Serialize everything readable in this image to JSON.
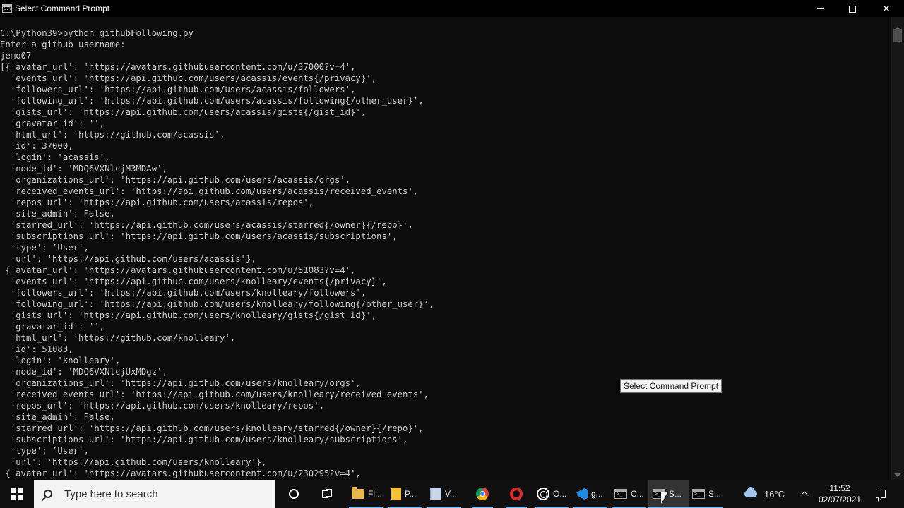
{
  "window": {
    "title": "Select Command Prompt",
    "icon": "cmd-icon",
    "controls": [
      "minimize-icon",
      "restore-icon",
      "close-icon"
    ]
  },
  "console": {
    "lines": [
      "C:\\Python39>python githubFollowing.py",
      "Enter a github username:",
      "jemo07",
      "[{'avatar_url': 'https://avatars.githubusercontent.com/u/37000?v=4',",
      "  'events_url': 'https://api.github.com/users/acassis/events{/privacy}',",
      "  'followers_url': 'https://api.github.com/users/acassis/followers',",
      "  'following_url': 'https://api.github.com/users/acassis/following{/other_user}',",
      "  'gists_url': 'https://api.github.com/users/acassis/gists{/gist_id}',",
      "  'gravatar_id': '',",
      "  'html_url': 'https://github.com/acassis',",
      "  'id': 37000,",
      "  'login': 'acassis',",
      "  'node_id': 'MDQ6VXNlcjM3MDAw',",
      "  'organizations_url': 'https://api.github.com/users/acassis/orgs',",
      "  'received_events_url': 'https://api.github.com/users/acassis/received_events',",
      "  'repos_url': 'https://api.github.com/users/acassis/repos',",
      "  'site_admin': False,",
      "  'starred_url': 'https://api.github.com/users/acassis/starred{/owner}{/repo}',",
      "  'subscriptions_url': 'https://api.github.com/users/acassis/subscriptions',",
      "  'type': 'User',",
      "  'url': 'https://api.github.com/users/acassis'},",
      " {'avatar_url': 'https://avatars.githubusercontent.com/u/51083?v=4',",
      "  'events_url': 'https://api.github.com/users/knolleary/events{/privacy}',",
      "  'followers_url': 'https://api.github.com/users/knolleary/followers',",
      "  'following_url': 'https://api.github.com/users/knolleary/following{/other_user}',",
      "  'gists_url': 'https://api.github.com/users/knolleary/gists{/gist_id}',",
      "  'gravatar_id': '',",
      "  'html_url': 'https://github.com/knolleary',",
      "  'id': 51083,",
      "  'login': 'knolleary',",
      "  'node_id': 'MDQ6VXNlcjUxMDgz',",
      "  'organizations_url': 'https://api.github.com/users/knolleary/orgs',",
      "  'received_events_url': 'https://api.github.com/users/knolleary/received_events',",
      "  'repos_url': 'https://api.github.com/users/knolleary/repos',",
      "  'site_admin': False,",
      "  'starred_url': 'https://api.github.com/users/knolleary/starred{/owner}{/repo}',",
      "  'subscriptions_url': 'https://api.github.com/users/knolleary/subscriptions',",
      "  'type': 'User',",
      "  'url': 'https://api.github.com/users/knolleary'},",
      " {'avatar_url': 'https://avatars.githubusercontent.com/u/230295?v=4',"
    ]
  },
  "tooltip": {
    "text": "Select Command Prompt"
  },
  "taskbar": {
    "start_icon": "windows-logo-icon",
    "search_placeholder": "Type here to search",
    "apps": [
      {
        "icon": "folder-icon",
        "label": "Fi..."
      },
      {
        "icon": "file-icon",
        "label": "P..."
      },
      {
        "icon": "document-icon",
        "label": "V..."
      },
      {
        "icon": "chrome-icon",
        "label": ""
      },
      {
        "icon": "opera-icon",
        "label": ""
      },
      {
        "icon": "obs-icon",
        "label": "O..."
      },
      {
        "icon": "vscode-icon",
        "label": "g..."
      },
      {
        "icon": "cmd-icon",
        "label": "C..."
      },
      {
        "icon": "cmd-icon",
        "label": "S..."
      },
      {
        "icon": "cmd-icon",
        "label": "S..."
      }
    ],
    "weather": {
      "icon": "cloud-icon",
      "temp": "16°C"
    },
    "time": "11:52",
    "date": "02/07/2021",
    "accent": "#76b9ed"
  }
}
